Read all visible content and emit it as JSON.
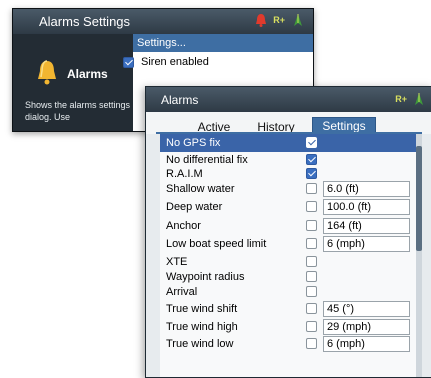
{
  "settings_window": {
    "title": "Alarms Settings",
    "icons": [
      "alarm-bell-icon",
      "r-plus-icon",
      "vessel-icon"
    ],
    "r_plus": "R+",
    "left_pane": {
      "label": "Alarms",
      "description": "Shows the alarms settings dialog. Use"
    },
    "menu": {
      "header": "Settings...",
      "items": [
        {
          "label": "Siren enabled",
          "checked": true
        }
      ]
    }
  },
  "alarms_window": {
    "title": "Alarms",
    "r_plus": "R+",
    "tabs": [
      {
        "label": "Active",
        "selected": false
      },
      {
        "label": "History",
        "selected": false
      },
      {
        "label": "Settings",
        "selected": true
      }
    ],
    "rows": [
      {
        "name": "No GPS fix",
        "checked": true,
        "value": "",
        "selected": true
      },
      {
        "name": "No differential fix",
        "checked": true,
        "value": ""
      },
      {
        "name": "R.A.I.M",
        "checked": true,
        "value": ""
      },
      {
        "name": "Shallow water",
        "checked": false,
        "value": "6.0 (ft)"
      },
      {
        "name": "Deep water",
        "checked": false,
        "value": "100.0 (ft)"
      },
      {
        "name": "Anchor",
        "checked": false,
        "value": "164 (ft)"
      },
      {
        "name": "Low boat speed limit",
        "checked": false,
        "value": "6 (mph)"
      },
      {
        "name": "XTE",
        "checked": false,
        "value": ""
      },
      {
        "name": "Waypoint radius",
        "checked": false,
        "value": ""
      },
      {
        "name": "Arrival",
        "checked": false,
        "value": ""
      },
      {
        "name": "True wind shift",
        "checked": false,
        "value": "45 (°)"
      },
      {
        "name": "True wind high",
        "checked": false,
        "value": "29 (mph)"
      },
      {
        "name": "True wind low",
        "checked": false,
        "value": "6 (mph)"
      }
    ]
  }
}
